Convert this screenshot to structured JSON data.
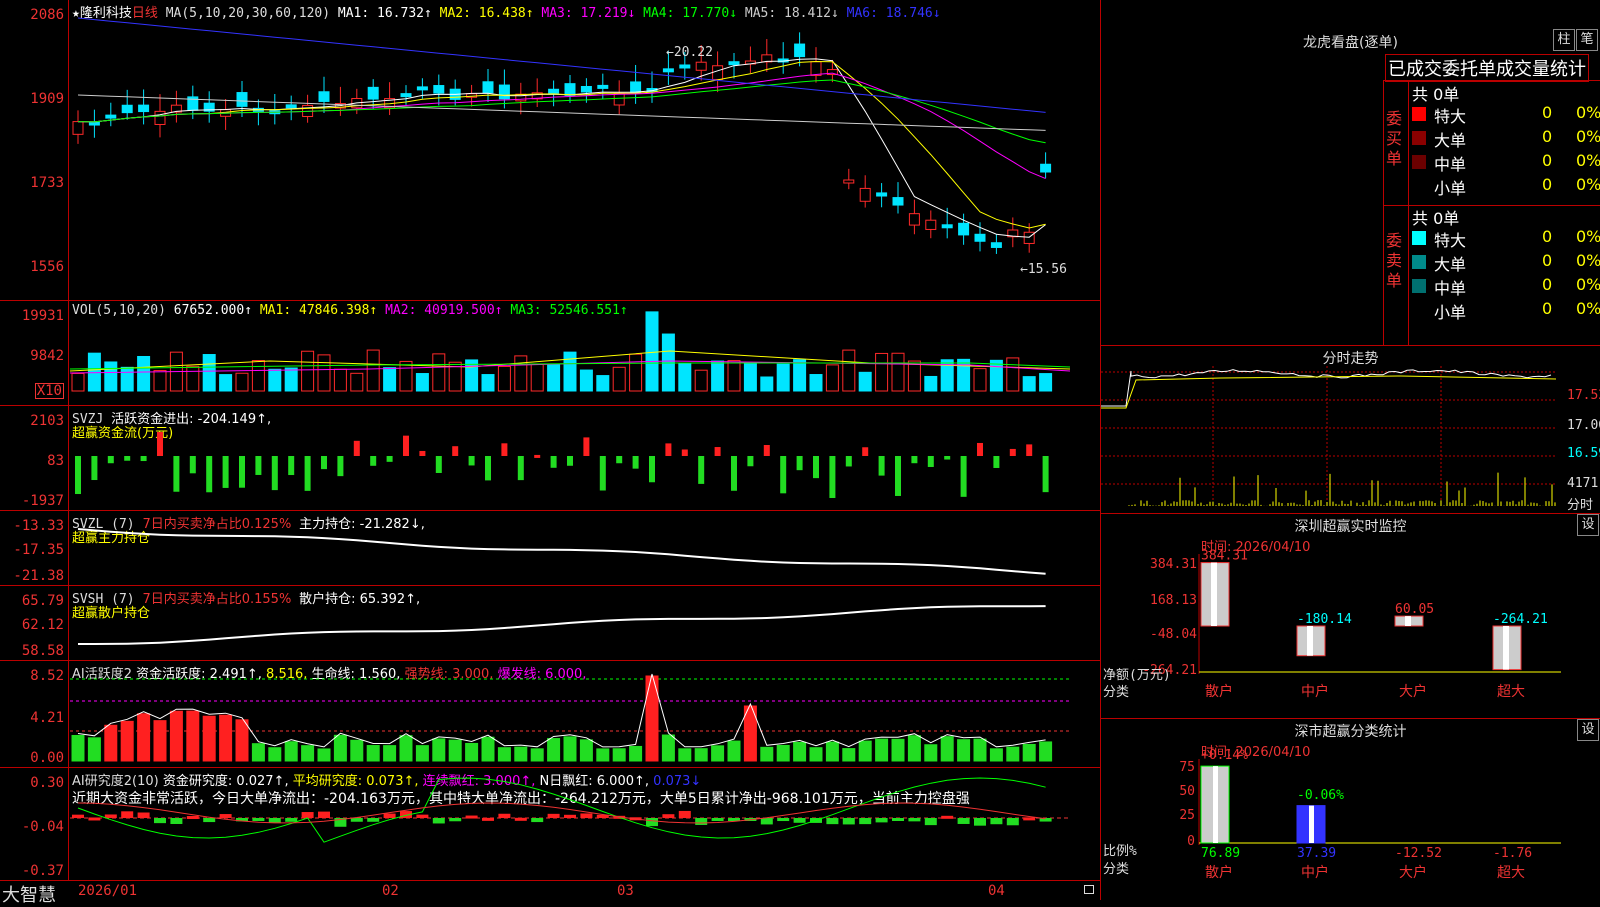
{
  "candles": {
    "stock_name": "隆利科技",
    "period": "日线",
    "ma_label": "MA(5,10,20,30,60,120)",
    "ma1": "MA1: 16.732↑",
    "ma2": "MA2: 16.438↑",
    "ma3": "MA3: 17.219↓",
    "ma4": "MA4: 17.770↓",
    "ma5": "MA5: 18.412↓",
    "ma6": "MA6: 18.746↓",
    "y_ticks": [
      "2086",
      "1909",
      "1733",
      "1556"
    ],
    "high_mark": "←20.22",
    "low_mark": "←15.56"
  },
  "vol": {
    "label": "VOL(5,10,20)",
    "value": "67652.000↑",
    "ma1": "MA1: 47846.398↑",
    "ma2": "MA2: 40919.500↑",
    "ma3": "MA3: 52546.551↑",
    "y_ticks": [
      "19931",
      "9842"
    ],
    "unit": "X10"
  },
  "svzj": {
    "label": "SVZJ",
    "value": "活跃资金进出: -204.149↑,",
    "sub": "超赢资金流(万元)",
    "y_ticks": [
      "2103",
      "83",
      "-1937"
    ]
  },
  "svzl": {
    "label": "SVZL (7)",
    "ratio": "7日内买卖净占比0.125%",
    "value": "主力持仓: -21.282↓,",
    "sub": "超赢主力持仓",
    "y_ticks": [
      "-13.33",
      "-17.35",
      "-21.38"
    ]
  },
  "svsh": {
    "label": "SVSH (7)",
    "ratio": "7日内买卖净占比0.155%",
    "value": "散户持仓: 65.392↑,",
    "sub": "超赢散户持仓",
    "y_ticks": [
      "65.79",
      "62.12",
      "58.58"
    ]
  },
  "ai_active": {
    "label": "AI活跃度2",
    "value": "资金活跃度: 2.491↑,",
    "v2": "8.516,",
    "life": "生命线: 1.560,",
    "strong": "强势线: 3.000,",
    "burst": "爆发线: 6.000,",
    "y_ticks": [
      "8.52",
      "4.21",
      "0.00"
    ]
  },
  "ai_research": {
    "label": "AI研究度2(10)",
    "value": "资金研究度: 0.027↑,",
    "avg": "平均研究度: 0.073↑,",
    "red": "连续飘红: 3.000↑,",
    "nred": "N日飘红: 6.000↑,",
    "last": "0.073↓",
    "comment": "近期大资金非常活跃，今日大单净流出：-204.163万元，其中特大单净流出：-264.212万元，大单5日累计净出-968.101万元，当前主力控盘强",
    "y_ticks": [
      "0.30",
      "-0.04",
      "-0.37"
    ]
  },
  "footer": {
    "brand": "大智慧",
    "dates": [
      "2026/01",
      "02",
      "03",
      "04"
    ]
  },
  "dragon": {
    "title": "龙虎看盘(逐单)",
    "btn1": "柱",
    "btn2": "笔",
    "tabs": "已成交委托单成交量统计",
    "buy_label": "委买单",
    "sell_label": "委卖单",
    "buy_total": "共 0单",
    "sell_total": "共 0单",
    "buy_rows": [
      {
        "name": "特大",
        "count": "0",
        "pct": "0%",
        "color": "#ff0000"
      },
      {
        "name": "大单",
        "count": "0",
        "pct": "0%",
        "color": "#8b0000"
      },
      {
        "name": "中单",
        "count": "0",
        "pct": "0%",
        "color": "#6b0000"
      },
      {
        "name": "小单",
        "count": "0",
        "pct": "0%",
        "color": "#000000"
      }
    ],
    "sell_rows": [
      {
        "name": "特大",
        "count": "0",
        "pct": "0%",
        "color": "#00ffff"
      },
      {
        "name": "大单",
        "count": "0",
        "pct": "0%",
        "color": "#008b8b"
      },
      {
        "name": "中单",
        "count": "0",
        "pct": "0%",
        "color": "#007070"
      },
      {
        "name": "小单",
        "count": "0",
        "pct": "0%",
        "color": "#000000"
      }
    ]
  },
  "intraday": {
    "title": "分时走势",
    "p1": "17.52",
    "p2": "17.06",
    "p3": "16.59",
    "vol": "4171",
    "vlabel": "分时"
  },
  "monitor": {
    "title": "深圳超赢实时监控",
    "btn": "设",
    "time": "时间: 2026/04/10",
    "y_ticks": [
      "384.31",
      "168.13",
      "-48.04",
      "-264.21"
    ],
    "ylabel1": "净额(万元)",
    "ylabel2": "分类",
    "bars": [
      {
        "name": "散户",
        "label": "384.31",
        "value": 384.31
      },
      {
        "name": "中户",
        "label": "-180.14",
        "value": -180.14
      },
      {
        "name": "大户",
        "label": "60.05",
        "value": 60.05
      },
      {
        "name": "超大",
        "label": "-264.21",
        "value": -264.21
      }
    ]
  },
  "classify": {
    "title": "深市超赢分类统计",
    "btn": "设",
    "time": "时间: 2026/04/10",
    "top1": "+0.14%",
    "top2": "-0.06%",
    "y_ticks": [
      "75",
      "50",
      "25",
      "0"
    ],
    "ylabel1": "比例%",
    "ylabel2": "分类",
    "bars": [
      {
        "name": "散户",
        "label": "76.89",
        "value": 76.89
      },
      {
        "name": "中户",
        "label": "37.39",
        "value": 37.39
      },
      {
        "name": "大户",
        "label": "-12.52",
        "value": -12.52
      },
      {
        "name": "超大",
        "label": "-1.76",
        "value": -1.76
      }
    ]
  }
}
